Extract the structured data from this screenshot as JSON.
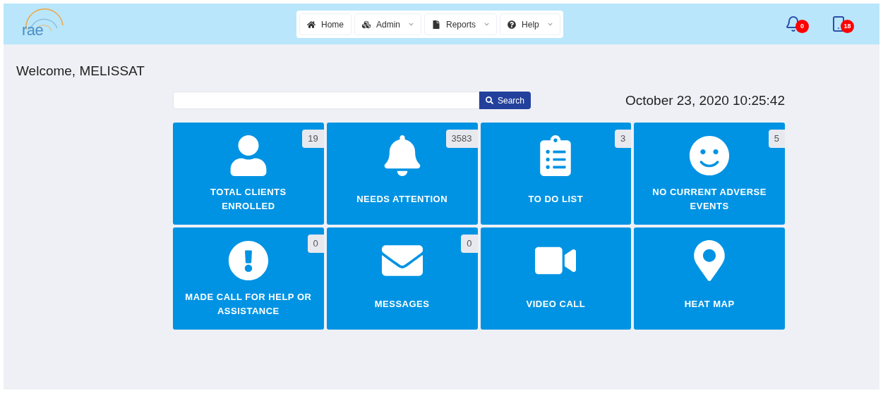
{
  "header": {
    "logo": "rae",
    "nav": [
      {
        "label": "Home",
        "kind": "home",
        "dropdown": false
      },
      {
        "label": "Admin",
        "kind": "admin",
        "dropdown": true
      },
      {
        "label": "Reports",
        "kind": "reports",
        "dropdown": true
      },
      {
        "label": "Help",
        "kind": "help",
        "dropdown": true
      }
    ],
    "alerts": [
      {
        "kind": "bell",
        "count": "0"
      },
      {
        "kind": "phone",
        "count": "18"
      }
    ]
  },
  "welcome": "Welcome, MELISSAT",
  "search": {
    "button": "Search"
  },
  "datetime": "October 23, 2020 10:25:42",
  "tiles": [
    {
      "kind": "user",
      "label": "TOTAL CLIENTS ENROLLED",
      "count": "19"
    },
    {
      "kind": "bell",
      "label": "NEEDS ATTENTION",
      "count": "3583"
    },
    {
      "kind": "clipboard",
      "label": "TO DO LIST",
      "count": "3"
    },
    {
      "kind": "smile",
      "label": "NO CURRENT ADVERSE EVENTS",
      "count": "5"
    },
    {
      "kind": "exclamation",
      "label": "MADE CALL FOR HELP OR ASSISTANCE",
      "count": "0"
    },
    {
      "kind": "envelope",
      "label": "MESSAGES",
      "count": "0"
    },
    {
      "kind": "video",
      "label": "VIDEO CALL"
    },
    {
      "kind": "marker",
      "label": "HEAT MAP"
    }
  ]
}
